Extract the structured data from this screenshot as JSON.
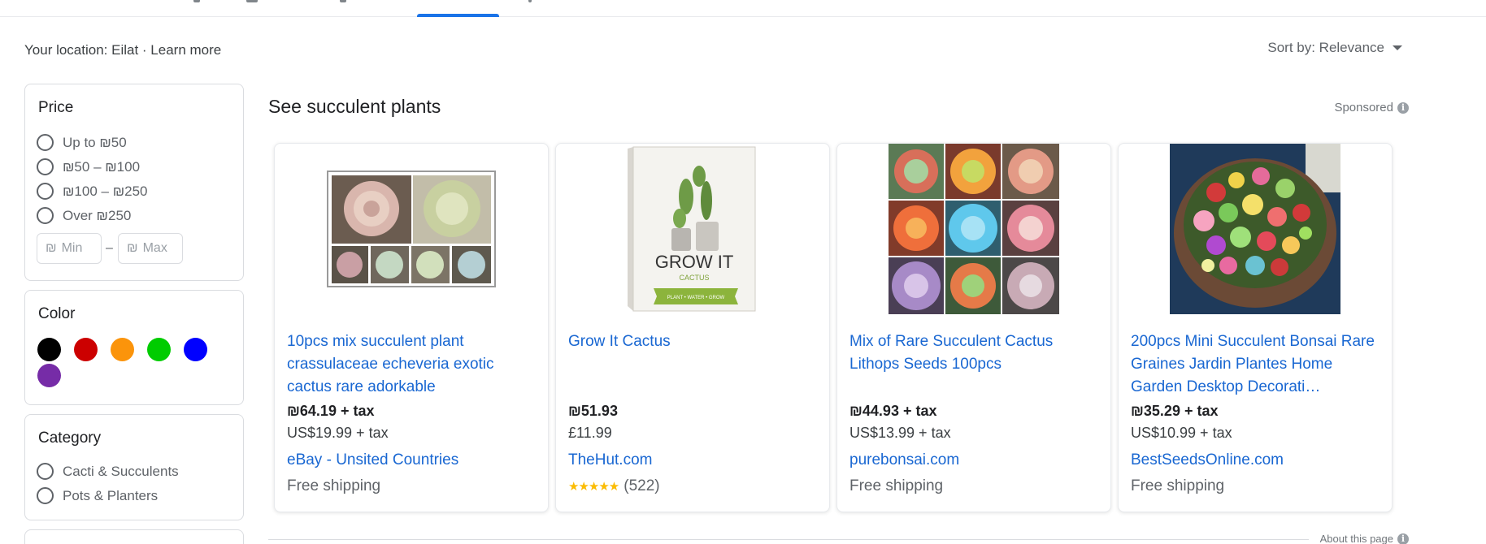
{
  "header": {
    "location_text": "Your location: Eilat",
    "separator": " · ",
    "learn_more": "Learn more",
    "sort_label": "Sort by: Relevance",
    "active_tab_color": "#1a73e8"
  },
  "filters": {
    "price": {
      "title": "Price",
      "options": [
        "Up to ₪50",
        "₪50 – ₪100",
        "₪100 – ₪250",
        "Over ₪250"
      ],
      "min_placeholder": "Min",
      "max_placeholder": "Max",
      "currency_symbol": "₪",
      "range_dash": "–"
    },
    "color": {
      "title": "Color",
      "swatches": [
        {
          "name": "black",
          "hex": "#000000"
        },
        {
          "name": "red",
          "hex": "#cc0000"
        },
        {
          "name": "orange",
          "hex": "#fb940b"
        },
        {
          "name": "green",
          "hex": "#00cc00"
        },
        {
          "name": "blue",
          "hex": "#0000ff"
        },
        {
          "name": "purple",
          "hex": "#762ca7"
        }
      ]
    },
    "category": {
      "title": "Category",
      "options": [
        "Cacti & Succulents",
        "Pots & Planters"
      ]
    }
  },
  "sponsored_section": {
    "title": "See succulent plants",
    "sponsored_label": "Sponsored",
    "info_icon": "i",
    "products": [
      {
        "title": "10pcs mix succulent plant crassulaceae echeveria exotic cactus rare adorkable",
        "price": "₪64.19 + tax",
        "price_alt": "US$19.99 + tax",
        "seller": "eBay - Unsited Countries",
        "shipping": "Free shipping"
      },
      {
        "title": "Grow It Cactus",
        "price": "₪51.93",
        "price_alt": "£11.99",
        "seller": "TheHut.com",
        "stars": "★★★★★",
        "rating": 4.5,
        "reviews": "(522)",
        "box_text": "GROW IT",
        "box_subtext": "CACTUS",
        "box_band": "PLANT • WATER • GROW"
      },
      {
        "title": "Mix of Rare Succulent Cactus Lithops Seeds 100pcs",
        "price": "₪44.93 + tax",
        "price_alt": "US$13.99 + tax",
        "seller": "purebonsai.com",
        "shipping": "Free shipping"
      },
      {
        "title": "200pcs Mini Succulent Bonsai Rare Graines Jardin Plantes Home Garden Desktop Decorati…",
        "price": "₪35.29 + tax",
        "price_alt": "US$10.99 + tax",
        "seller": "BestSeedsOnline.com",
        "shipping": "Free shipping"
      }
    ]
  },
  "footer": {
    "about_label": "About this page"
  }
}
